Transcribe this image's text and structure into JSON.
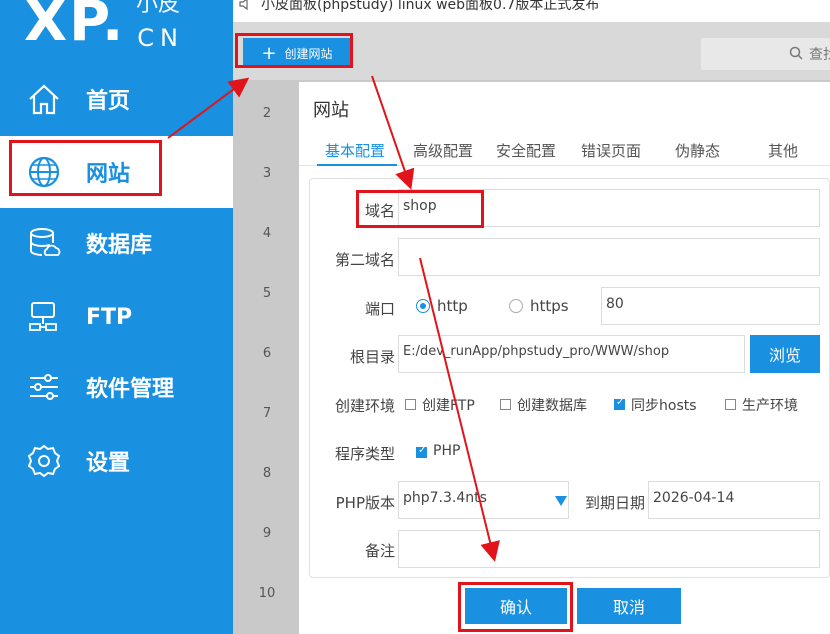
{
  "window": {
    "title": "小皮面板(phpstudy) linux web面板0.7版本正式发布"
  },
  "sidebar": {
    "logo": {
      "big": "XP.",
      "small": "CN",
      "cn": "小皮"
    },
    "items": [
      {
        "label": "首页",
        "icon": "home-icon"
      },
      {
        "label": "网站",
        "icon": "globe-icon"
      },
      {
        "label": "数据库",
        "icon": "database-icon"
      },
      {
        "label": "FTP",
        "icon": "ftp-icon"
      },
      {
        "label": "软件管理",
        "icon": "sliders-icon"
      },
      {
        "label": "设置",
        "icon": "gear-icon"
      }
    ]
  },
  "toolbar": {
    "create_label": "创建网站",
    "search_label": "查找"
  },
  "table": {
    "row_numbers": [
      "2",
      "3",
      "4",
      "5",
      "6",
      "7",
      "8",
      "9",
      "10"
    ]
  },
  "dialog": {
    "title": "网站",
    "tabs": [
      "基本配置",
      "高级配置",
      "安全配置",
      "错误页面",
      "伪静态",
      "其他"
    ],
    "form": {
      "domain_label": "域名",
      "domain_value": "shop",
      "second_domain_label": "第二域名",
      "second_domain_value": "",
      "port_label": "端口",
      "port_options": [
        "http",
        "https"
      ],
      "port_selected": "http",
      "port_value": "80",
      "root_label": "根目录",
      "root_value": "E:/dev_runApp/phpstudy_pro/WWW/shop",
      "browse_label": "浏览",
      "env_label": "创建环境",
      "env_options": [
        {
          "label": "创建FTP",
          "checked": false
        },
        {
          "label": "创建数据库",
          "checked": false
        },
        {
          "label": "同步hosts",
          "checked": true
        },
        {
          "label": "生产环境",
          "checked": false
        }
      ],
      "program_label": "程序类型",
      "program_option": {
        "label": "PHP",
        "checked": true
      },
      "php_label": "PHP版本",
      "php_value": "php7.3.4nts",
      "expire_label": "到期日期",
      "expire_value": "2026-04-14",
      "note_label": "备注",
      "note_value": ""
    },
    "ok_label": "确认",
    "cancel_label": "取消"
  },
  "colors": {
    "accent": "#1a90e0",
    "annotation": "#e0141a"
  }
}
